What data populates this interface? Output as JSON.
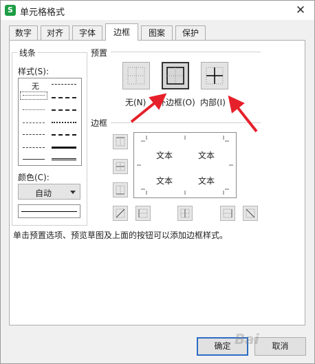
{
  "window": {
    "title": "单元格格式",
    "close_symbol": "✕",
    "app_icon_letter": "S"
  },
  "tabs": [
    {
      "label": "数字"
    },
    {
      "label": "对齐"
    },
    {
      "label": "字体"
    },
    {
      "label": "边框"
    },
    {
      "label": "图案"
    },
    {
      "label": "保护"
    }
  ],
  "active_tab": "边框",
  "lines_group": {
    "title": "线条",
    "style_label": "样式(S):",
    "none_label": "无",
    "color_label": "颜色(C):",
    "color_value": "自动"
  },
  "presets": {
    "title": "预置",
    "none_label": "无(N)",
    "outline_label": "外边框(O)",
    "inside_label": "内部(I)"
  },
  "border": {
    "title": "边框",
    "preview_text": [
      "文本",
      "文本",
      "文本",
      "文本"
    ]
  },
  "hint": "单击预置选项、预览草图及上面的按钮可以添加边框样式。",
  "buttons": {
    "ok": "确定",
    "cancel": "取消"
  },
  "watermark": "Bai",
  "colors": {
    "arrow": "#e6202a",
    "ok_border": "#2b6cc4",
    "app_icon": "#1e9e45"
  }
}
